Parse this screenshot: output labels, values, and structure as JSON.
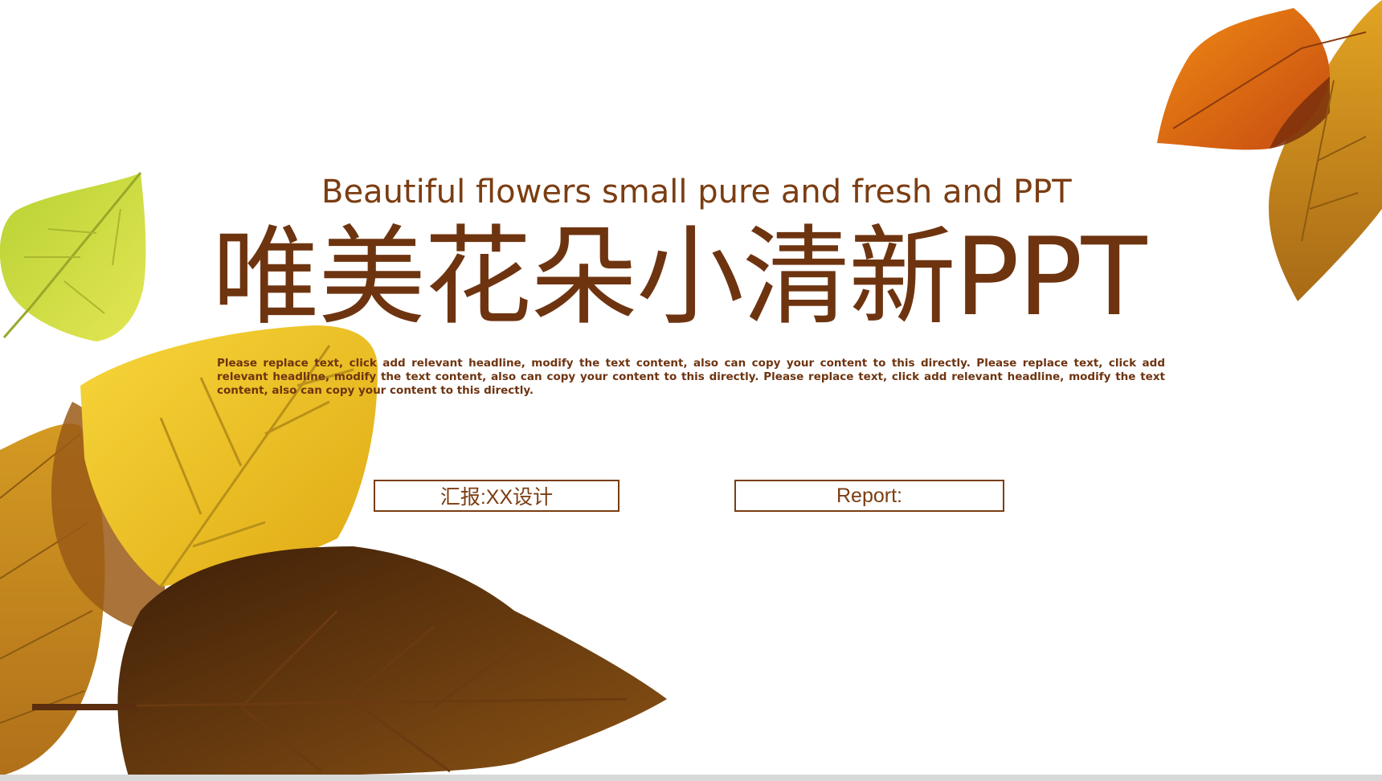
{
  "slide": {
    "subtitle": "Beautiful flowers small pure and fresh and PPT",
    "title": "唯美花朵小清新PPT",
    "body": "Please replace text, click add relevant headline, modify the text content, also can copy your content to this directly. Please replace text, click add relevant headline, modify the text content, also can copy your content to this directly. Please replace text, click add relevant headline, modify the text content, also can copy your content to this directly.",
    "reporter_label": "汇报:XX设计",
    "report_label": "Report:"
  },
  "colors": {
    "text_brown": "#6e3410",
    "leaf_yellow": "#f2c41f",
    "leaf_green": "#c6d932",
    "leaf_dark": "#5a2e0e",
    "leaf_orange": "#e66a12",
    "leaf_amber": "#c98d1c"
  },
  "icons": {
    "decor_top_left": "green-leaf-icon",
    "decor_bottom_left": "autumn-leaf-cluster-icon",
    "decor_top_right": "orange-leaf-icon"
  }
}
